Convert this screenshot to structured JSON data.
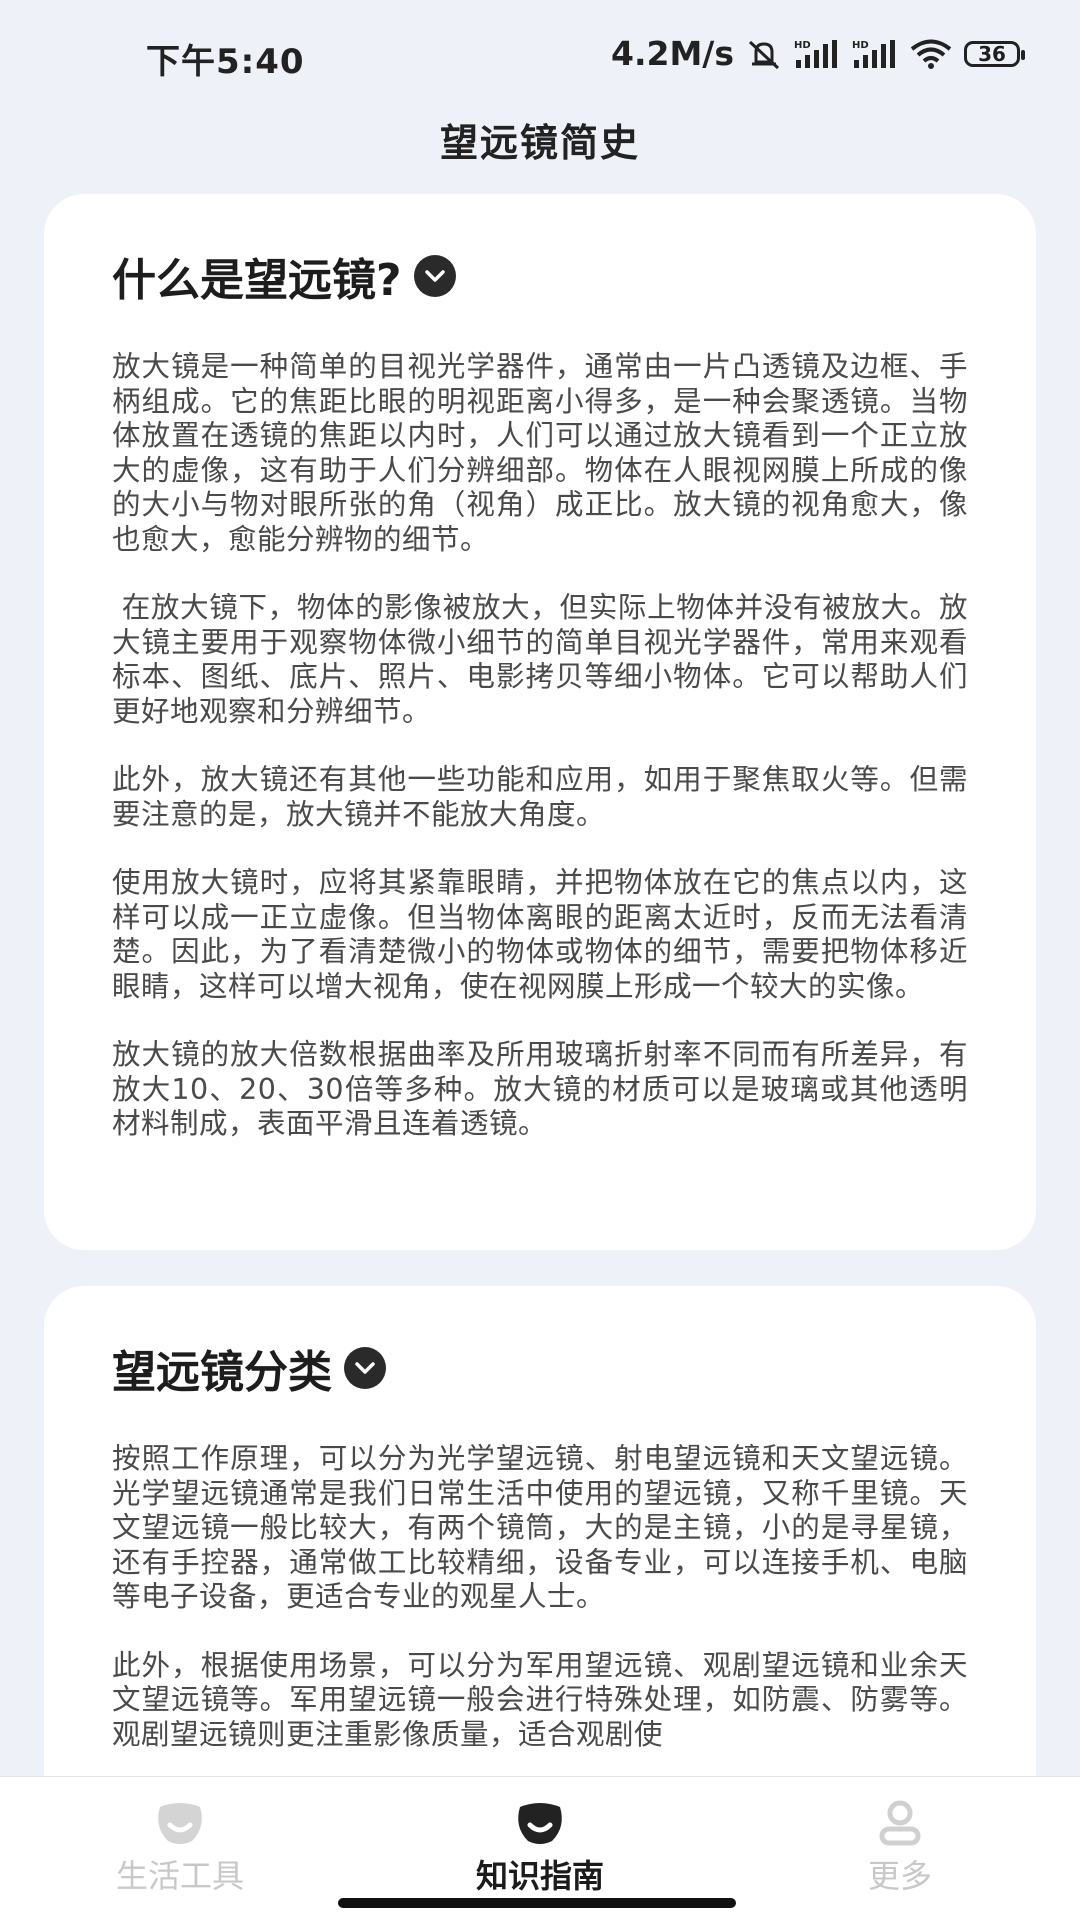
{
  "status_bar": {
    "time": "下午5:40",
    "speed": "4.2M/s",
    "battery": "36"
  },
  "header": {
    "title": "望远镜简史"
  },
  "sections": [
    {
      "heading": "什么是望远镜?",
      "paragraphs": [
        "放大镜是一种简单的目视光学器件，通常由一片凸透镜及边框、手柄组成。它的焦距比眼的明视距离小得多，是一种会聚透镜。当物体放置在透镜的焦距以内时，人们可以通过放大镜看到一个正立放大的虚像，这有助于人们分辨细部。物体在人眼视网膜上所成的像的大小与物对眼所张的角（视角）成正比。放大镜的视角愈大，像也愈大，愈能分辨物的细节。",
        " 在放大镜下，物体的影像被放大，但实际上物体并没有被放大。放大镜主要用于观察物体微小细节的简单目视光学器件，常用来观看标本、图纸、底片、照片、电影拷贝等细小物体。它可以帮助人们更好地观察和分辨细节。",
        "此外，放大镜还有其他一些功能和应用，如用于聚焦取火等。但需要注意的是，放大镜并不能放大角度。",
        "使用放大镜时，应将其紧靠眼睛，并把物体放在它的焦点以内，这样可以成一正立虚像。但当物体离眼的距离太近时，反而无法看清楚。因此，为了看清楚微小的物体或物体的细节，需要把物体移近眼睛，这样可以增大视角，使在视网膜上形成一个较大的实像。",
        "放大镜的放大倍数根据曲率及所用玻璃折射率不同而有所差异，有放大10、20、30倍等多种。放大镜的材质可以是玻璃或其他透明材料制成，表面平滑且连着透镜。"
      ]
    },
    {
      "heading": "望远镜分类",
      "paragraphs": [
        "按照工作原理，可以分为光学望远镜、射电望远镜和天文望远镜。光学望远镜通常是我们日常生活中使用的望远镜，又称千里镜。天文望远镜一般比较大，有两个镜筒，大的是主镜，小的是寻星镜，还有手控器，通常做工比较精细，设备专业，可以连接手机、电脑等电子设备，更适合专业的观星人士。",
        "此外，根据使用场景，可以分为军用望远镜、观剧望远镜和业余天文望远镜等。军用望远镜一般会进行特殊处理，如防震、防雾等。观剧望远镜则更注重影像质量，适合观剧使"
      ]
    }
  ],
  "bottom_nav": {
    "items": [
      {
        "label": "生活工具",
        "icon": "tools-icon",
        "active": false
      },
      {
        "label": "知识指南",
        "icon": "guide-icon",
        "active": true
      },
      {
        "label": "更多",
        "icon": "person-icon",
        "active": false
      }
    ]
  },
  "colors": {
    "background": "#eef1f7",
    "card": "#ffffff",
    "text": "#4a4a4a",
    "heading": "#1d1d1d",
    "nav_inactive": "#c8c8c8",
    "nav_active": "#1b1b1b"
  }
}
